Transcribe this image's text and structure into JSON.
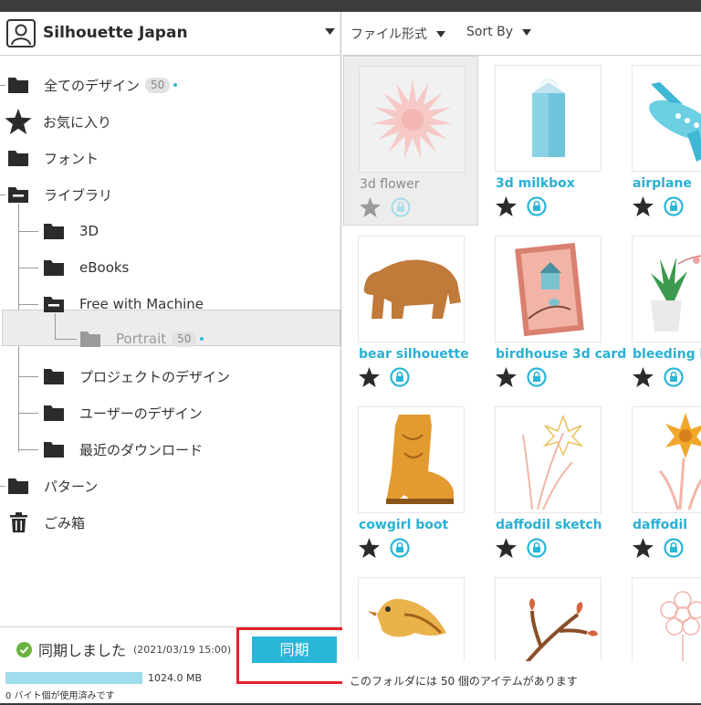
{
  "account": {
    "name": "Silhouette Japan"
  },
  "tree": {
    "all_designs": {
      "label": "全てのデザイン",
      "count": "50"
    },
    "favorites": {
      "label": "お気に入り"
    },
    "fonts": {
      "label": "フォント"
    },
    "library": {
      "label": "ライブラリ"
    },
    "lib_3d": {
      "label": "3D"
    },
    "lib_ebooks": {
      "label": "eBooks"
    },
    "lib_free": {
      "label": "Free with Machine"
    },
    "lib_portrait": {
      "label": "Portrait",
      "count": "50"
    },
    "lib_project": {
      "label": "プロジェクトのデザイン"
    },
    "lib_user": {
      "label": "ユーザーのデザイン"
    },
    "lib_recent": {
      "label": "最近のダウンロード"
    },
    "patterns": {
      "label": "パターン"
    },
    "trash": {
      "label": "ごみ箱"
    }
  },
  "sync": {
    "status": "同期しました",
    "timestamp": "(2021/03/19 15:00)",
    "button": "同期",
    "storage": "1024.0 MB",
    "used": "0 バイト個が使用済みです"
  },
  "filters": {
    "file_format": "ファイル形式",
    "sort_by": "Sort By"
  },
  "designs": [
    {
      "name": "3d flower"
    },
    {
      "name": "3d milkbox"
    },
    {
      "name": "airplane"
    },
    {
      "name": "bear silhouette"
    },
    {
      "name": "birdhouse 3d card"
    },
    {
      "name": "bleeding heart"
    },
    {
      "name": "cowgirl boot"
    },
    {
      "name": "daffodil sketch"
    },
    {
      "name": "daffodil"
    },
    {
      "name": ""
    },
    {
      "name": ""
    },
    {
      "name": ""
    }
  ],
  "status_bar": "このフォルダには 50 個のアイテムがあります",
  "colors": {
    "accent": "#29b6d8",
    "highlight": "#e5202b"
  }
}
